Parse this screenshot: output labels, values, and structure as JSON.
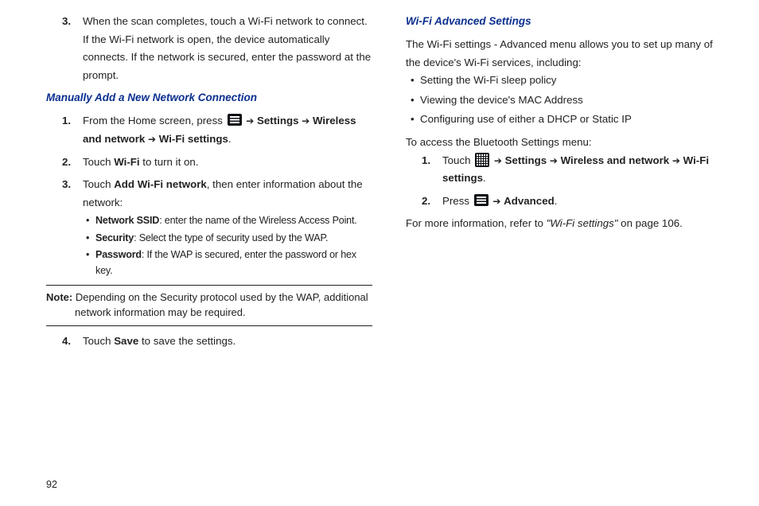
{
  "pageNumber": "92",
  "arrow": "➔",
  "left": {
    "step3": "When the scan completes, touch a Wi-Fi network to connect. If the Wi-Fi network is open, the device automatically connects. If the network is secured, enter the password at the prompt.",
    "heading": "Manually Add a New Network Connection",
    "s1_a": "From the Home screen, press ",
    "s1_b": "Settings",
    "s1_c": "Wireless and network",
    "s1_d": "Wi-Fi settings",
    "s1_e": ".",
    "s2_a": "Touch ",
    "s2_b": "Wi-Fi",
    "s2_c": " to turn it on.",
    "s3_a": "Touch ",
    "s3_b": "Add Wi-Fi network",
    "s3_c": ", then enter information about the network:",
    "sub1_a": "Network SSID",
    "sub1_b": ": enter the name of the Wireless Access Point.",
    "sub2_a": "Security",
    "sub2_b": ": Select the type of security used by the WAP.",
    "sub3_a": "Password",
    "sub3_b": ": If the WAP is secured, enter the password or hex key.",
    "note_a": "Note:",
    "note_b": " Depending on the Security protocol used by the WAP, additional network information may be required.",
    "s4_a": "Touch ",
    "s4_b": "Save",
    "s4_c": " to save the settings."
  },
  "right": {
    "heading": "Wi-Fi Advanced Settings",
    "intro": "The Wi-Fi settings - Advanced menu allows you to set up many of the device's Wi-Fi services, including:",
    "b1": "Setting the Wi-Fi sleep policy",
    "b2": "Viewing the device's MAC Address",
    "b3": "Configuring use of either a DHCP or Static IP",
    "access": "To access the Bluetooth Settings menu:",
    "s1_a": "Touch  ",
    "s1_b": "Settings",
    "s1_c": "Wireless and network",
    "s1_d": "Wi-Fi settings",
    "s1_e": ".",
    "s2_a": "Press ",
    "s2_b": "Advanced",
    "s2_c": ".",
    "ref_a": "For more information, refer to ",
    "ref_b": "\"Wi-Fi settings\" ",
    "ref_c": " on page 106."
  }
}
